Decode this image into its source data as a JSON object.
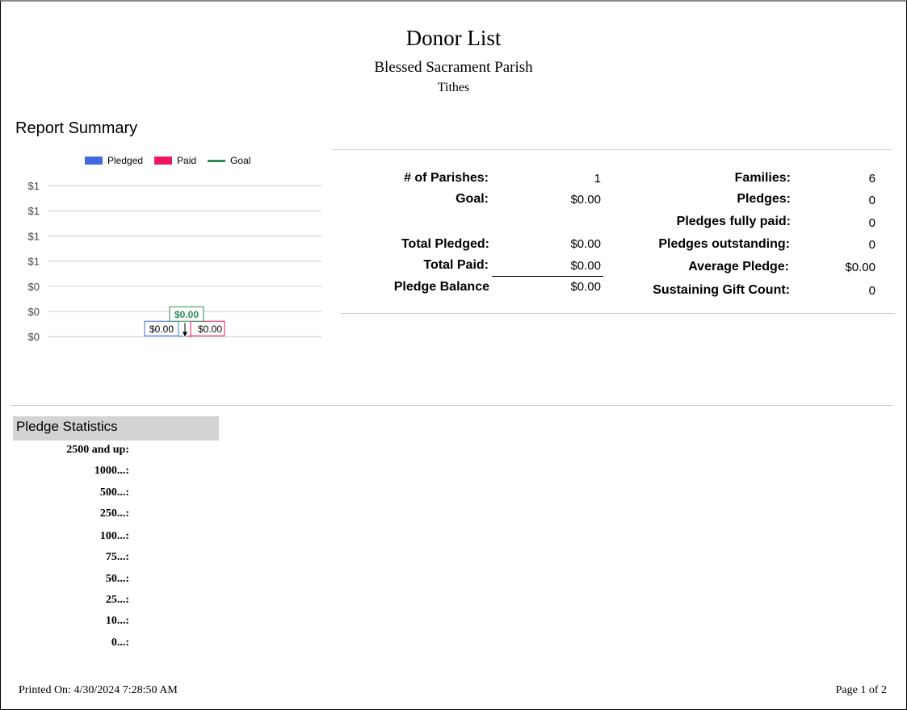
{
  "header": {
    "title": "Donor List",
    "parish": "Blessed Sacrament Parish",
    "fund": "Tithes"
  },
  "summary": {
    "heading": "Report Summary",
    "legend": [
      {
        "label": "Pledged",
        "color": "#4169e1",
        "kind": "box"
      },
      {
        "label": "Paid",
        "color": "#f0165f",
        "kind": "box"
      },
      {
        "label": "Goal",
        "color": "#2e8b57",
        "kind": "line"
      }
    ],
    "stats_left": [
      {
        "label": "# of Parishes:",
        "value": "1"
      },
      {
        "label": "Goal:",
        "value": "$0.00"
      },
      {
        "label": "Total Pledged:",
        "value": "$0.00"
      },
      {
        "label": "Total Paid:",
        "value": "$0.00"
      },
      {
        "label": "Pledge Balance",
        "value": "$0.00"
      }
    ],
    "stats_right": [
      {
        "label": "Families:",
        "value": "6"
      },
      {
        "label": "Pledges:",
        "value": "0"
      },
      {
        "label": "Pledges fully paid:",
        "value": "0"
      },
      {
        "label": "Pledges outstanding:",
        "value": "0"
      },
      {
        "label": "Average Pledge:",
        "value": "$0.00"
      },
      {
        "label": "Sustaining Gift Count:",
        "value": "0"
      }
    ]
  },
  "chart_data": {
    "type": "bar",
    "categories": [
      ""
    ],
    "series": [
      {
        "name": "Pledged",
        "values": [
          0
        ],
        "label": "$0.00"
      },
      {
        "name": "Paid",
        "values": [
          0
        ],
        "label": "$0.00"
      },
      {
        "name": "Goal",
        "values": [
          0
        ],
        "label": "$0.00"
      }
    ],
    "y_tick_labels": [
      "$1",
      "$1",
      "$1",
      "$1",
      "$0",
      "$0",
      "$0"
    ],
    "ylim": [
      0,
      1
    ],
    "grid": true,
    "legend": "top",
    "colors": {
      "pledged": "#4169e1",
      "paid": "#f0165f",
      "goal": "#2e8b57"
    }
  },
  "pledge_statistics": {
    "heading": "Pledge Statistics",
    "rows": [
      "2500 and up:",
      "1000...:",
      "500...:",
      "250...:",
      "100...:",
      "75...:",
      "50...:",
      "25...:",
      "10...:",
      "0...:"
    ]
  },
  "footer": {
    "printed": "Printed On: 4/30/2024 7:28:50 AM",
    "page": "Page 1 of 2"
  }
}
